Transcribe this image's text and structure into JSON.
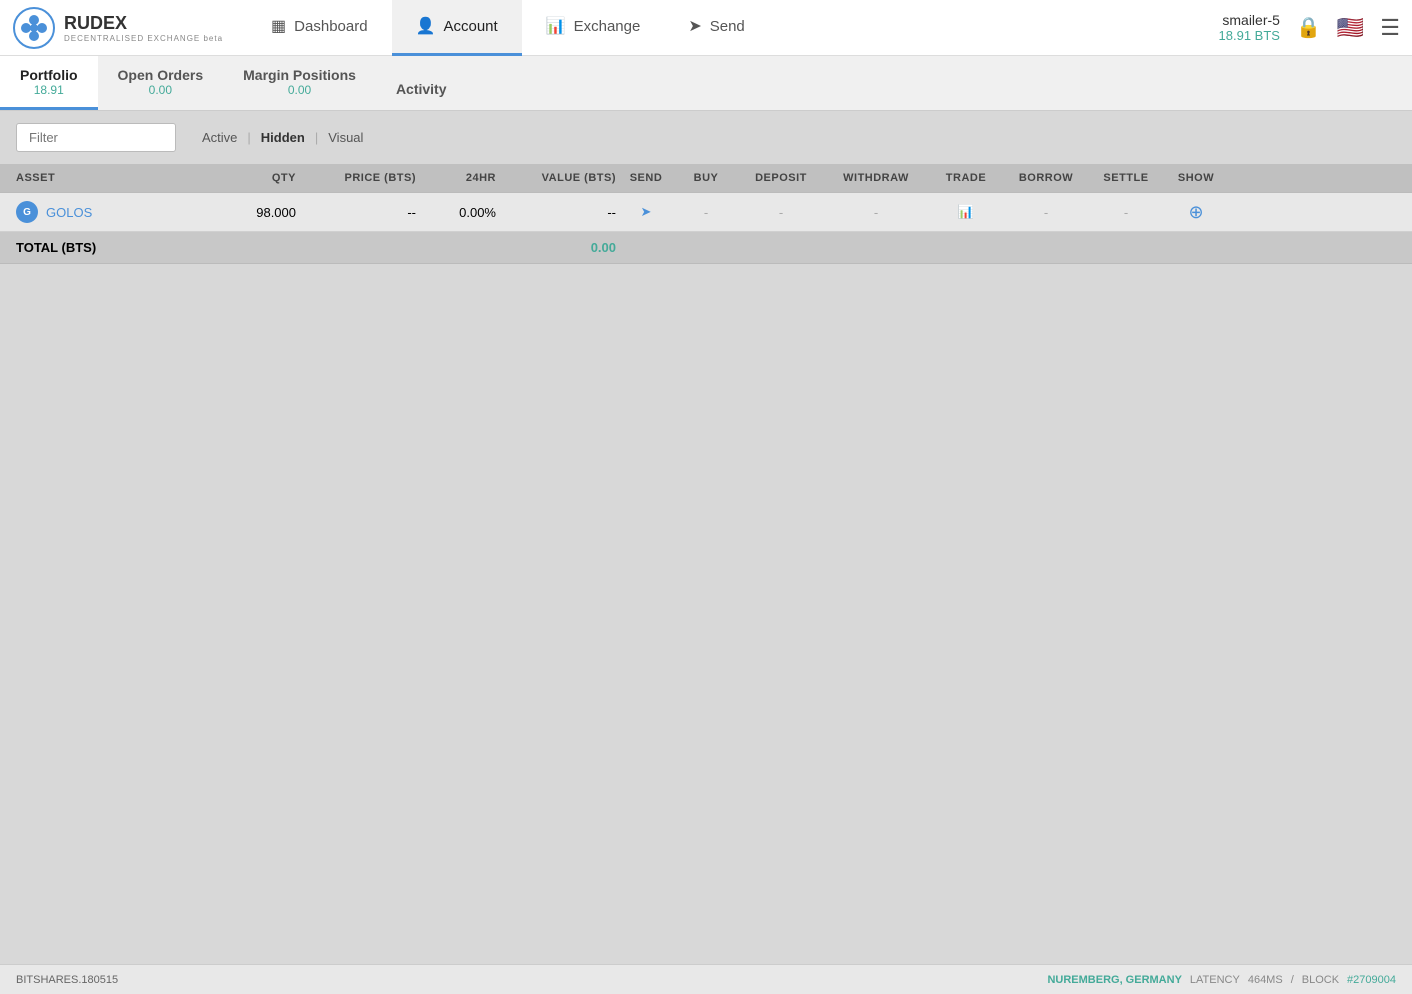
{
  "app": {
    "name": "RUDEX",
    "subtitle": "DECENTRALISED EXCHANGE beta"
  },
  "nav": {
    "items": [
      {
        "id": "dashboard",
        "label": "Dashboard",
        "icon": "▦",
        "active": false
      },
      {
        "id": "account",
        "label": "Account",
        "icon": "👤",
        "active": true
      },
      {
        "id": "exchange",
        "label": "Exchange",
        "icon": "📊",
        "active": false
      },
      {
        "id": "send",
        "label": "Send",
        "icon": "➤",
        "active": false
      }
    ],
    "user": {
      "name": "smailer-5",
      "balance": "18.91 BTS"
    }
  },
  "sub_tabs": [
    {
      "id": "portfolio",
      "label": "Portfolio",
      "value": "18.91",
      "active": true
    },
    {
      "id": "open-orders",
      "label": "Open Orders",
      "value": "0.00",
      "active": false
    },
    {
      "id": "margin-positions",
      "label": "Margin Positions",
      "value": "0.00",
      "active": false
    },
    {
      "id": "activity",
      "label": "Activity",
      "value": null,
      "active": false
    }
  ],
  "filter": {
    "placeholder": "Filter",
    "options": [
      {
        "id": "active",
        "label": "Active",
        "active": false
      },
      {
        "id": "hidden",
        "label": "Hidden",
        "active": true
      },
      {
        "id": "visual",
        "label": "Visual",
        "active": false
      }
    ]
  },
  "table": {
    "columns": [
      "ASSET",
      "QTY",
      "PRICE (BTS)",
      "24HR",
      "VALUE (BTS)",
      "SEND",
      "BUY",
      "DEPOSIT",
      "WITHDRAW",
      "TRADE",
      "BORROW",
      "SETTLE",
      "SHOW"
    ],
    "rows": [
      {
        "asset": "GOLOS",
        "asset_color": "#4a90d9",
        "qty": "98.000",
        "price_bts": "--",
        "change_24hr": "0.00%",
        "value_bts": "--",
        "send": "➤",
        "buy": "-",
        "deposit": "-",
        "withdraw": "-",
        "trade": "📊",
        "borrow": "-",
        "settle": "-",
        "show": "+"
      }
    ],
    "total": {
      "label": "TOTAL (BTS)",
      "value": "0.00"
    }
  },
  "footer": {
    "version": "BITSHARES.180515",
    "location": "NUREMBERG, GERMANY",
    "latency_label": "LATENCY",
    "latency_value": "464MS",
    "block_label": "BLOCK",
    "block_value": "#2709004"
  }
}
